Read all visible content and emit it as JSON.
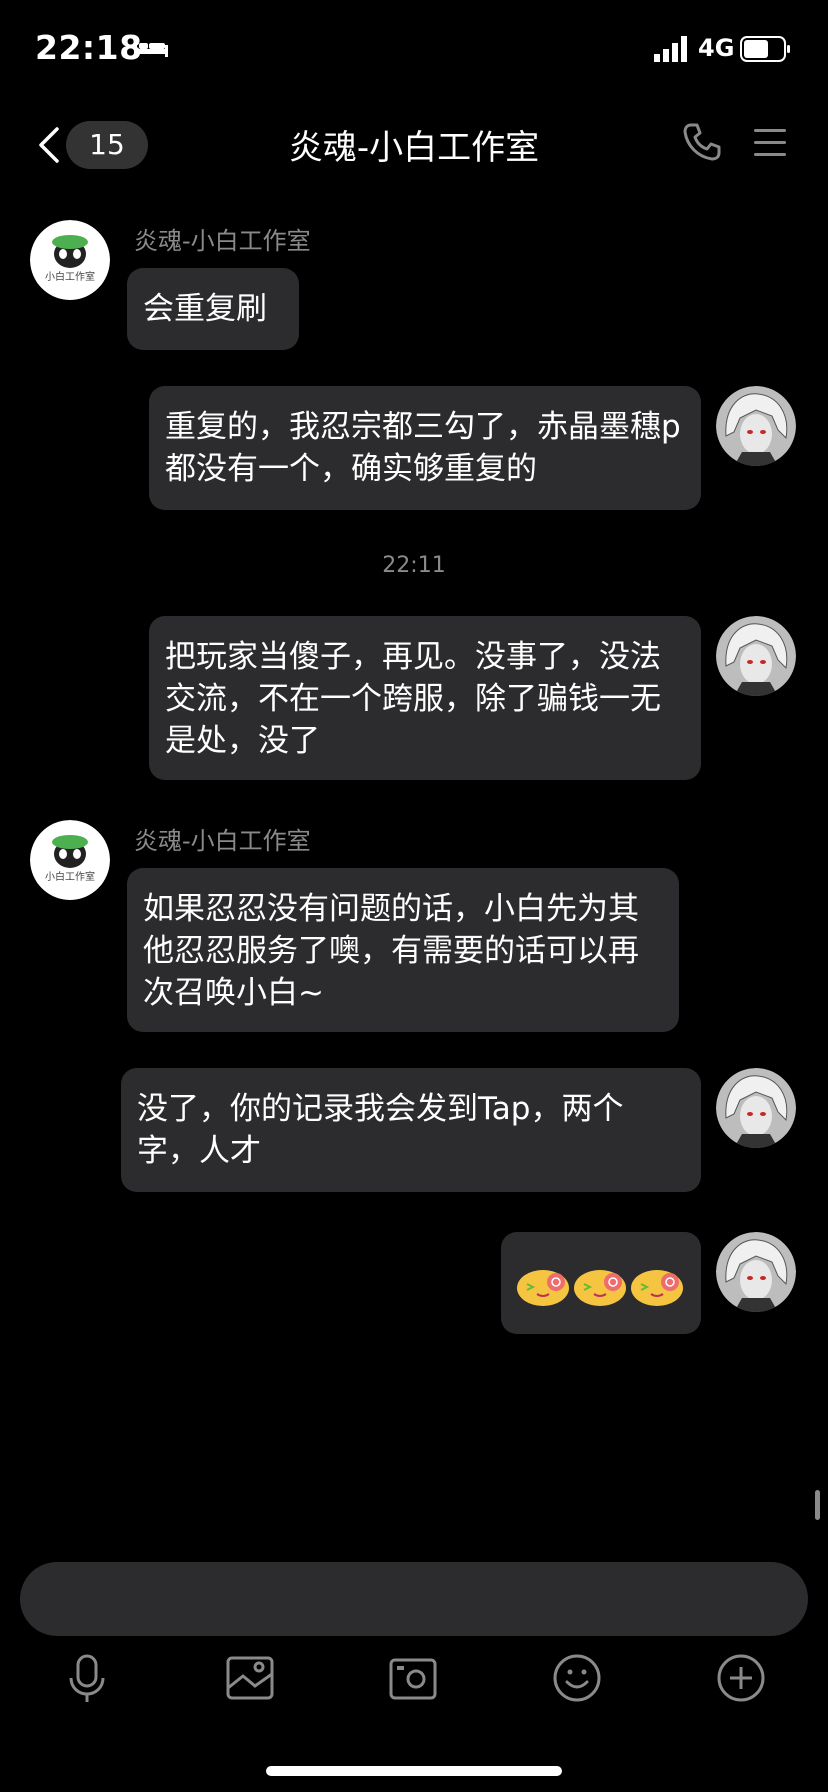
{
  "status_bar": {
    "time": "22:18",
    "network": "4G"
  },
  "header": {
    "unread_count": "15",
    "title": "炎魂-小白工作室"
  },
  "messages": [
    {
      "side": "left",
      "sender": "炎魂-小白工作室",
      "text": "会重复刷"
    },
    {
      "side": "right",
      "text": "重复的，我忍宗都三勾了，赤晶墨穗p都没有一个，确实够重复的"
    },
    {
      "type": "time",
      "text": "22:11"
    },
    {
      "side": "right",
      "text": "把玩家当傻子，再见。没事了，没法交流，不在一个跨服，除了骗钱一无是处，没了"
    },
    {
      "side": "left",
      "sender": "炎魂-小白工作室",
      "text": "如果忍忍没有问题的话，小白先为其他忍忍服务了噢，有需要的话可以再次召唤小白~"
    },
    {
      "side": "right",
      "text": "没了，你的记录我会发到Tap，两个字，人才"
    },
    {
      "side": "right",
      "type": "stickers",
      "count": 3
    }
  ],
  "input": {
    "placeholder": ""
  },
  "toolbar": [
    "microphone-icon",
    "photo-icon",
    "camera-icon",
    "emoji-icon",
    "plus-icon"
  ],
  "colors": {
    "background": "#000000",
    "bubble": "#2c2c2e",
    "secondary_text": "#8a8a8a"
  }
}
